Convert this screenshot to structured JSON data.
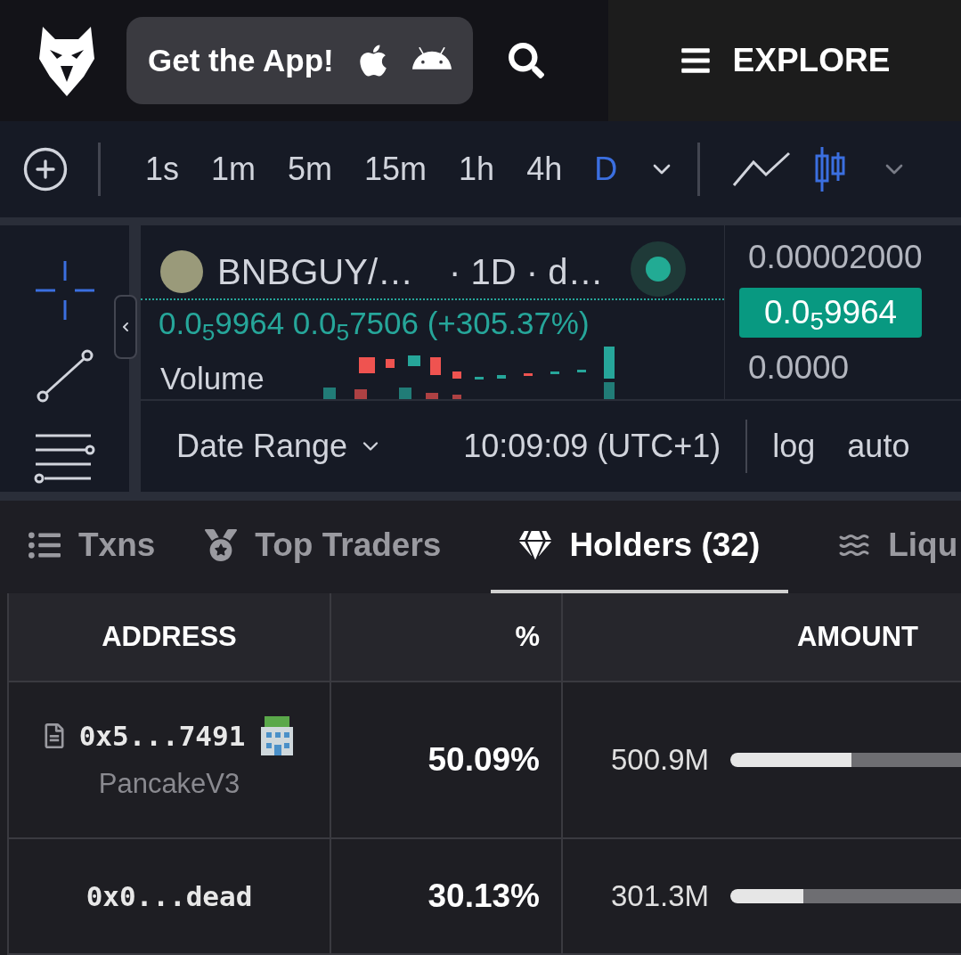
{
  "header": {
    "app_button": "Get the App!",
    "explore": "EXPLORE"
  },
  "timeframes": [
    {
      "label": "1s",
      "selected": false
    },
    {
      "label": "1m",
      "selected": false
    },
    {
      "label": "5m",
      "selected": false
    },
    {
      "label": "15m",
      "selected": false
    },
    {
      "label": "1h",
      "selected": false
    },
    {
      "label": "4h",
      "selected": false
    },
    {
      "label": "D",
      "selected": true
    }
  ],
  "chart_types": [
    {
      "kind": "line",
      "selected": false
    },
    {
      "kind": "candles",
      "selected": true
    }
  ],
  "chart": {
    "symbol": "BNBGUY/…",
    "interval": "· 1D · d…",
    "legend": "0.0$_{5}$9964  0.0$_{5}$7506 (+305.37%)",
    "volume": "Volume",
    "price_scale": [
      {
        "label": "0.00002000",
        "current": false
      },
      {
        "label": "0.0$_{5}$9964",
        "current": true
      },
      {
        "label": "0.0000",
        "current": false
      }
    ],
    "date_range": "Date Range",
    "time": "10:09:09 (UTC+1)",
    "log": "log",
    "auto": "auto"
  },
  "tabs": [
    {
      "label": "Txns",
      "kind": "list",
      "selected": false
    },
    {
      "label": "Top Traders",
      "kind": "medal",
      "selected": false
    },
    {
      "label": "Holders (32)",
      "kind": "diamond",
      "selected": true
    },
    {
      "label": "Liqu",
      "kind": "waves",
      "selected": false
    }
  ],
  "table": {
    "columns": [
      "ADDRESS",
      "%",
      "AMOUNT"
    ],
    "rows": [
      {
        "address": "0x5...7491",
        "contract": true,
        "tag": "PancakeV3",
        "percent": "50.09%",
        "amount": "500.9M",
        "level": 0.5009
      },
      {
        "address": "0x0...dead",
        "contract": false,
        "percent": "30.13%",
        "amount": "301.3M",
        "level": 0.3013
      }
    ]
  }
}
